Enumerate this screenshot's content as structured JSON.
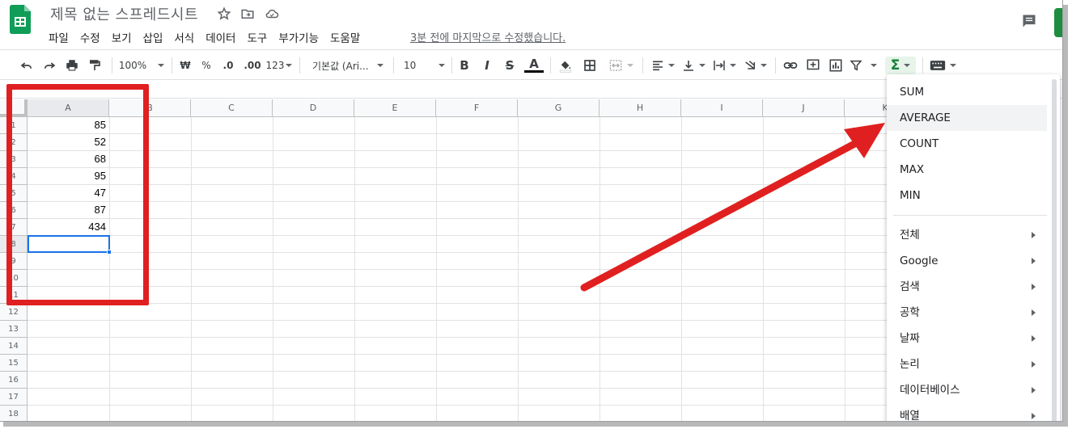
{
  "header": {
    "title": "제목 없는 스프레드시트",
    "last_edit": "3분 전에 마지막으로 수정했습니다."
  },
  "menu": [
    "파일",
    "수정",
    "보기",
    "삽입",
    "서식",
    "데이터",
    "도구",
    "부가기능",
    "도움말"
  ],
  "toolbar": {
    "zoom": "100%",
    "currency": "₩",
    "percent": "%",
    "decrease_decimal": ".0",
    "increase_decimal": ".00",
    "more_formats": "123",
    "font": "기본값 (Ari...",
    "font_size": "10",
    "bold": "B",
    "italic": "I",
    "strike": "S",
    "text_color": "A",
    "functions": "Σ"
  },
  "columns": [
    "A",
    "B",
    "C",
    "D",
    "E",
    "F",
    "G",
    "H",
    "I",
    "J",
    "K"
  ],
  "row_numbers": [
    "1",
    "2",
    "3",
    "4",
    "5",
    "6",
    "7",
    "8",
    "9",
    "10",
    "11",
    "12",
    "13",
    "14",
    "15",
    "16",
    "17",
    "18"
  ],
  "cells_a": [
    "85",
    "52",
    "68",
    "95",
    "47",
    "87",
    "434"
  ],
  "functions_menu": {
    "common": [
      "SUM",
      "AVERAGE",
      "COUNT",
      "MAX",
      "MIN"
    ],
    "highlighted": "AVERAGE",
    "categories": [
      "전체",
      "Google",
      "검색",
      "공학",
      "날짜",
      "논리",
      "데이터베이스",
      "배열"
    ]
  },
  "colors": {
    "accent": "#1a73e8",
    "annotation": "#e02020",
    "sheets_green": "#0f9d58"
  }
}
